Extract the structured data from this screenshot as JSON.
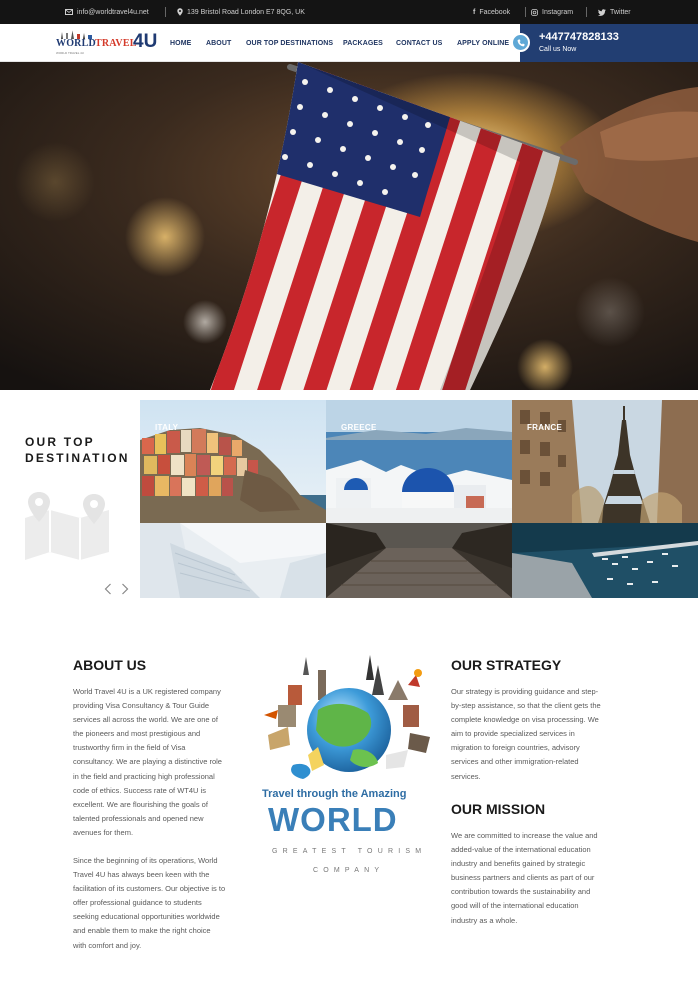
{
  "topbar": {
    "email": "info@worldtravel4u.net",
    "address": "139 Bristol Road London E7 8QG, UK",
    "social": [
      "Facebook",
      "Instagram",
      "Twitter"
    ]
  },
  "logo": {
    "line1": "WORLD",
    "line2": "TRAVEL",
    "mark": "4U",
    "tagline": "WORLD TRAVEL 4U"
  },
  "nav": {
    "items": [
      "HOME",
      "ABOUT",
      "OUR TOP DESTINATIONS",
      "PACKAGES",
      "CONTACT US",
      "APPLY ONLINE"
    ]
  },
  "call": {
    "number": "+447747828133",
    "label": "Call us Now"
  },
  "destinations": {
    "heading_line1": "OUR TOP",
    "heading_line2": "DESTINATION",
    "tiles": [
      "ITALY",
      "GREECE",
      "FRANCE"
    ]
  },
  "about": {
    "heading": "ABOUT US",
    "para1": "World Travel 4U is a UK registered company\nproviding Visa Consultancy & Tour Guide\nservices all across the world. We are one of\nthe pioneers and most prestigious and\ntrustworthy firm in the field of Visa\nconsultancy. We are playing a distinctive role\nin the field and practicing high professional\ncode of ethics. Success rate of WT4U is\nexcellent. We are flourishing the goals of\ntalented professionals and opened new\navenues for them.",
    "para2": "Since the beginning of its operations, World\nTravel 4U has always been keen with the\nfacilitation of its customers. Our objective is to\noffer professional guidance to students\nseeking educational opportunities worldwide\nand enable them to make the right choice\nwith comfort and joy."
  },
  "center": {
    "tagline": "Travel through the Amazing",
    "world": "WORLD",
    "greatest": "GREATEST TOURISM",
    "company": "COMPANY"
  },
  "strategy": {
    "heading": "OUR STRATEGY",
    "text": "Our strategy is providing guidance and step-\nby-step assistance, so that the client gets the\ncomplete knowledge on visa processing. We\naim to provide specialized services in\nmigration to foreign countries, advisory\nservices and other immigration-related\nservices."
  },
  "mission": {
    "heading": "OUR MISSION",
    "text": "We are committed to increase the value and\nadded-value of the international education\nindustry and benefits gained by strategic\nbusiness partners and clients as part of our\ncontribution towards the sustainability and\ngood will of the international education\nindustry as a whole."
  },
  "colors": {
    "navy": "#223e72",
    "nav_text": "#1f3561",
    "accent_blue": "#5fa8d6",
    "topbar": "#141414"
  }
}
